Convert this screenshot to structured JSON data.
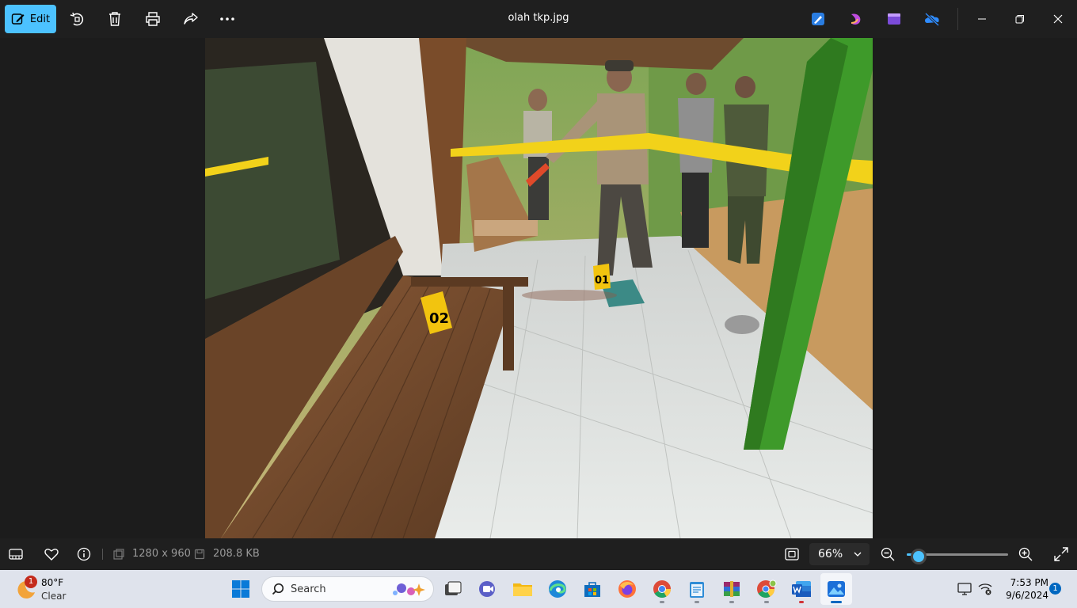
{
  "titlebar": {
    "edit_label": "Edit",
    "file_title": "olah tkp.jpg"
  },
  "image": {
    "markers": [
      "02",
      "01"
    ]
  },
  "statusbar": {
    "dimensions": "1280 x 960",
    "file_size": "208.8 KB",
    "zoom_label": "66%",
    "zoom_fraction": 0.12
  },
  "taskbar": {
    "weather_temp": "80°F",
    "weather_condition": "Clear",
    "weather_badge": "1",
    "search_placeholder": "Search",
    "time": "7:53 PM",
    "date": "9/6/2024",
    "notification_count": "1"
  },
  "colors": {
    "accent": "#4cc2ff",
    "titlebar_bg": "#1f1f1f",
    "viewer_bg": "#1c1c1c",
    "taskbar_bg": "#dfe3ec"
  }
}
